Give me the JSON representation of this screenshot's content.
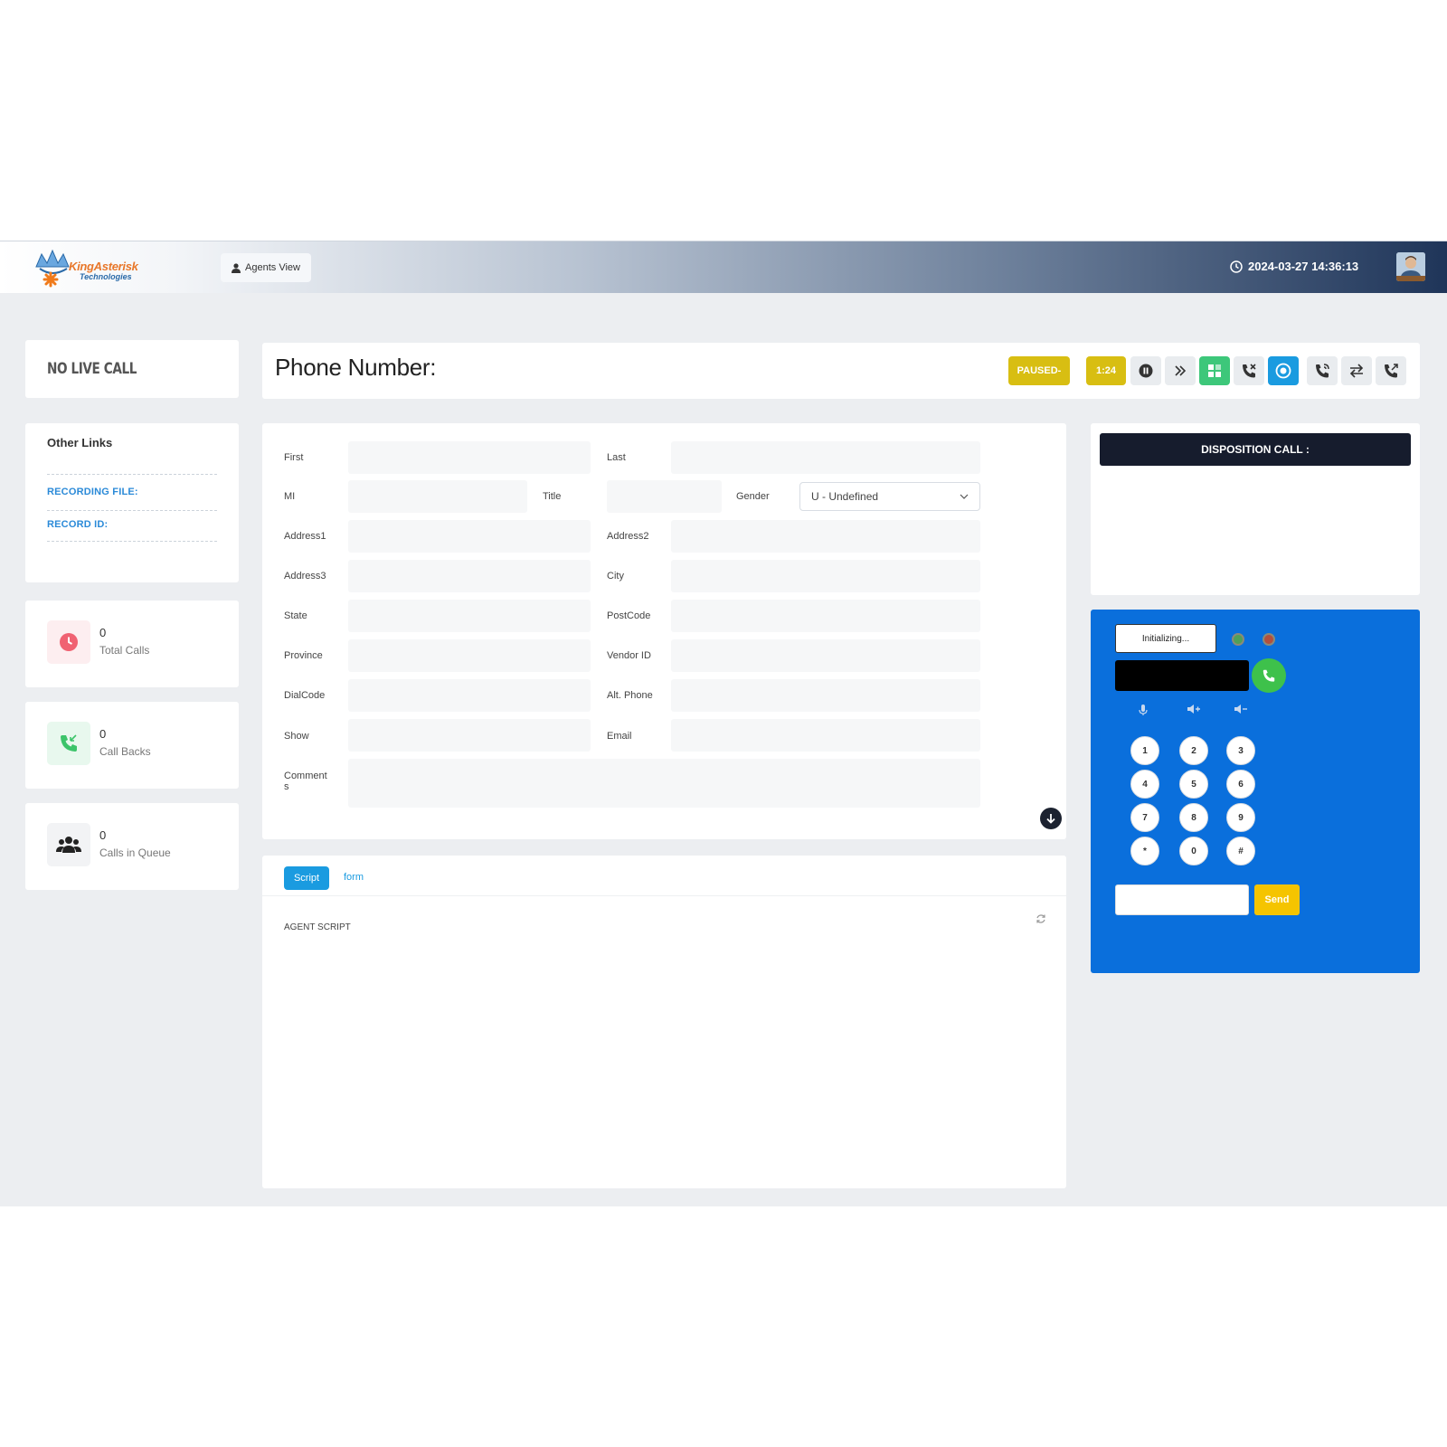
{
  "header": {
    "logo_brand": "KingAsterisk",
    "logo_sub": "Technologies",
    "agents_view_label": "Agents View",
    "datetime": "2024-03-27 14:36:13"
  },
  "sidebar": {
    "no_live_call": "NO LIVE CALL",
    "other_links": {
      "title": "Other Links",
      "recording_file": "RECORDING FILE:",
      "record_id": "RECORD ID:"
    },
    "stats": [
      {
        "value": "0",
        "label": "Total Calls",
        "icon": "clock-icon",
        "color": "#f06272"
      },
      {
        "value": "0",
        "label": "Call Backs",
        "icon": "phone-incoming-icon",
        "color": "#3cc46a"
      },
      {
        "value": "0",
        "label": "Calls in Queue",
        "icon": "users-icon",
        "color": "#222222"
      }
    ]
  },
  "phonebar": {
    "title": "Phone Number:",
    "status_badge": "PAUSED-",
    "timer": "1:24",
    "buttons": [
      "pause-icon",
      "forward-icon",
      "grid-icon",
      "call-hangup-icon",
      "record-icon",
      "phone-icon",
      "transfer-icon",
      "phone-outgoing-icon"
    ]
  },
  "form": {
    "labels": {
      "first": "First",
      "last": "Last",
      "mi": "MI",
      "title": "Title",
      "gender": "Gender",
      "address1": "Address1",
      "address2": "Address2",
      "address3": "Address3",
      "city": "City",
      "state": "State",
      "postcode": "PostCode",
      "province": "Province",
      "vendor_id": "Vendor ID",
      "dialcode": "DialCode",
      "alt_phone": "Alt. Phone",
      "show": "Show",
      "email": "Email",
      "comments_1": "Comment",
      "comments_2": "s"
    },
    "gender_value": "U - Undefined"
  },
  "script": {
    "tab_script": "Script",
    "tab_form": "form",
    "agent_script": "AGENT SCRIPT"
  },
  "disposition": {
    "title": "DISPOSITION CALL :"
  },
  "softphone": {
    "status": "Initializing...",
    "keys": [
      "1",
      "2",
      "3",
      "4",
      "5",
      "6",
      "7",
      "8",
      "9",
      "*",
      "0",
      "#"
    ],
    "send_label": "Send",
    "colors": {
      "panel": "#0a6fdc",
      "call": "#3ec14b",
      "send": "#f5c400"
    }
  },
  "colors": {
    "paused": "#d8be12",
    "grid_button": "#3dc77a",
    "record_button": "#1a9be0",
    "disposition_bar": "#161c2d"
  }
}
